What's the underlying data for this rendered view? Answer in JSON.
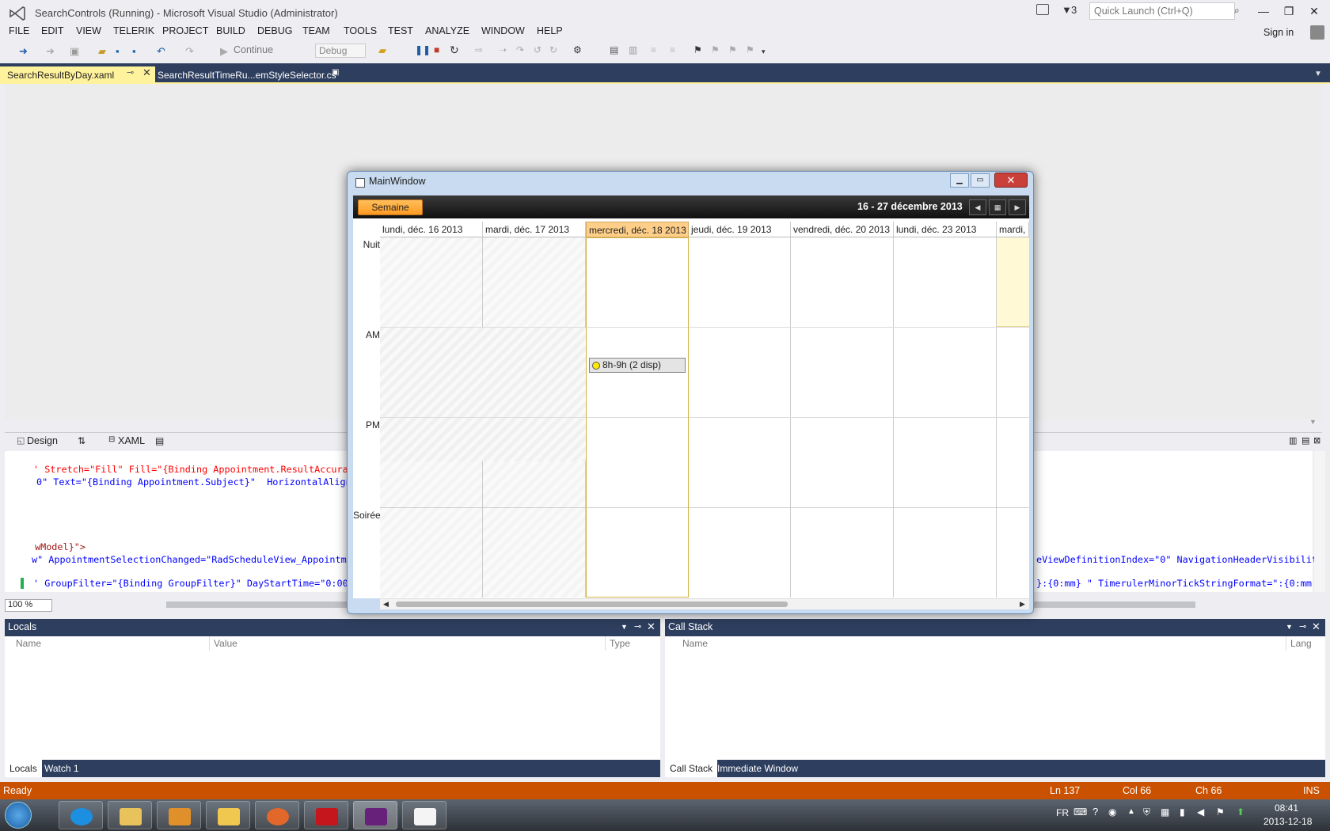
{
  "titlebar": {
    "title": "SearchControls (Running) - Microsoft Visual Studio (Administrator)",
    "notification_count": "3",
    "quick_launch_placeholder": "Quick Launch (Ctrl+Q)",
    "sign_in": "Sign in"
  },
  "menu": [
    "FILE",
    "EDIT",
    "VIEW",
    "TELERIK",
    "PROJECT",
    "BUILD",
    "DEBUG",
    "TEAM",
    "TOOLS",
    "TEST",
    "ANALYZE",
    "WINDOW",
    "HELP"
  ],
  "toolbar": {
    "continue_label": "Continue",
    "configuration": "Debug"
  },
  "doc_tabs": [
    {
      "label": "SearchResultByDay.xaml",
      "active": true
    },
    {
      "label": "SearchResultTimeRu...emStyleSelector.cs",
      "active": false
    }
  ],
  "design_bar": {
    "design_label": "Design",
    "xaml_label": "XAML"
  },
  "xaml_code": {
    "line1a": "' Stretch=\"Fill\" Fill=\"{Binding Appointment.ResultAccurac",
    "line2a": "0\" Text=\"{Binding Appointment.Subject}\"  HorizontalAlign",
    "line3a": "wModel}\">",
    "line4a": "w\" AppointmentSelectionChanged=\"RadScheduleView_Appointme",
    "line4b": "eViewDefinitionIndex=\"0\" NavigationHeaderVisibilit",
    "line5a": "' GroupFilter=\"{Binding GroupFilter}\" DayStartTime=\"0:00\"",
    "line5b": "}:{0:mm} \" TimerulerMinorTickStringFormat=\":{0:mm"
  },
  "zoom": "100 %",
  "main_window": {
    "title": "MainWindow",
    "view_button": "Semaine",
    "date_range": "16  - 27 décembre 2013",
    "days": [
      "lundi, déc. 16 2013",
      "mardi, déc. 17 2013",
      "mercredi, déc. 18 2013",
      "jeudi, déc. 19 2013",
      "vendredi, déc. 20 2013",
      "lundi, déc. 23 2013",
      "mardi, d"
    ],
    "time_slots": [
      "Nuit",
      "AM",
      "PM",
      "Soirée"
    ],
    "appointment": "8h-9h (2 disp)"
  },
  "locals_panel": {
    "title": "Locals",
    "columns": [
      "Name",
      "Value",
      "Type"
    ],
    "tabs": [
      "Locals",
      "Watch 1"
    ]
  },
  "callstack_panel": {
    "title": "Call Stack",
    "columns": [
      "Name",
      "Lang"
    ],
    "tabs": [
      "Call Stack",
      "Immediate Window"
    ]
  },
  "statusbar": {
    "status": "Ready",
    "line": "Ln 137",
    "col": "Col 66",
    "ch": "Ch 66",
    "mode": "INS"
  },
  "taskbar": {
    "lang": "FR",
    "time": "08:41",
    "date": "2013-12-18"
  },
  "colors": {
    "accent_blue": "#2d3e5e",
    "status_orange": "#ca5100",
    "active_tab_yellow": "#fff29d",
    "semaine_orange": "#ff9a22"
  }
}
